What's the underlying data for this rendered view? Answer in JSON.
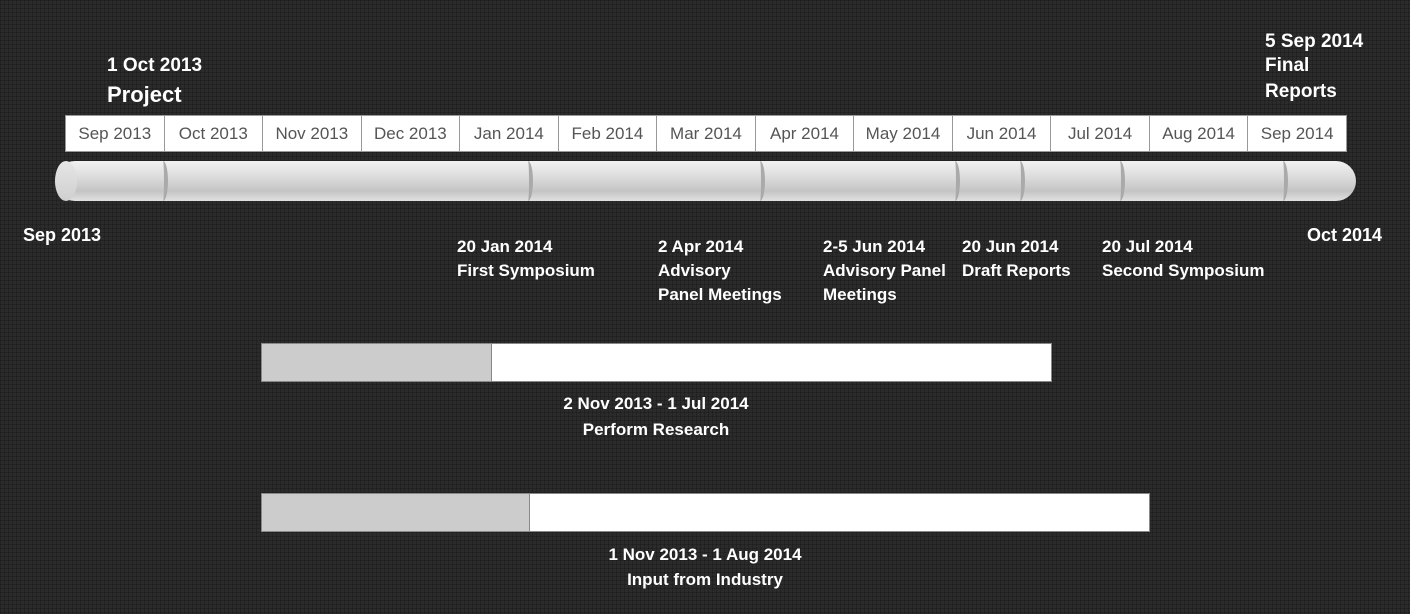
{
  "project": {
    "date": "1 Oct 2013",
    "label": "Project"
  },
  "final": {
    "date": "5 Sep 2014",
    "line1": "Final",
    "line2": "Reports"
  },
  "months": [
    "Sep 2013",
    "Oct 2013",
    "Nov 2013",
    "Dec 2013",
    "Jan 2014",
    "Feb 2014",
    "Mar 2014",
    "Apr 2014",
    "May 2014",
    "Jun 2014",
    "Jul 2014",
    "Aug 2014",
    "Sep 2014"
  ],
  "range_start": "Sep 2013",
  "range_end": "Oct 2014",
  "milestones": [
    {
      "date": "20 Jan 2014",
      "line1": "First Symposium",
      "line2": ""
    },
    {
      "date": "2 Apr 2014",
      "line1": "Advisory",
      "line2": "Panel Meetings"
    },
    {
      "date": "2-5 Jun 2014",
      "line1": "Advisory Panel",
      "line2": "Meetings"
    },
    {
      "date": "20 Jun 2014",
      "line1": "Draft Reports",
      "line2": ""
    },
    {
      "date": "20 Jul 2014",
      "line1": "Second Symposium",
      "line2": ""
    }
  ],
  "tasks": [
    {
      "dates": "2 Nov 2013 - 1 Jul 2014",
      "name": "Perform Research",
      "progress": 0.29
    },
    {
      "dates": "1 Nov 2013 - 1 Aug 2014",
      "name": "Input from Industry",
      "progress": 0.3
    }
  ]
}
